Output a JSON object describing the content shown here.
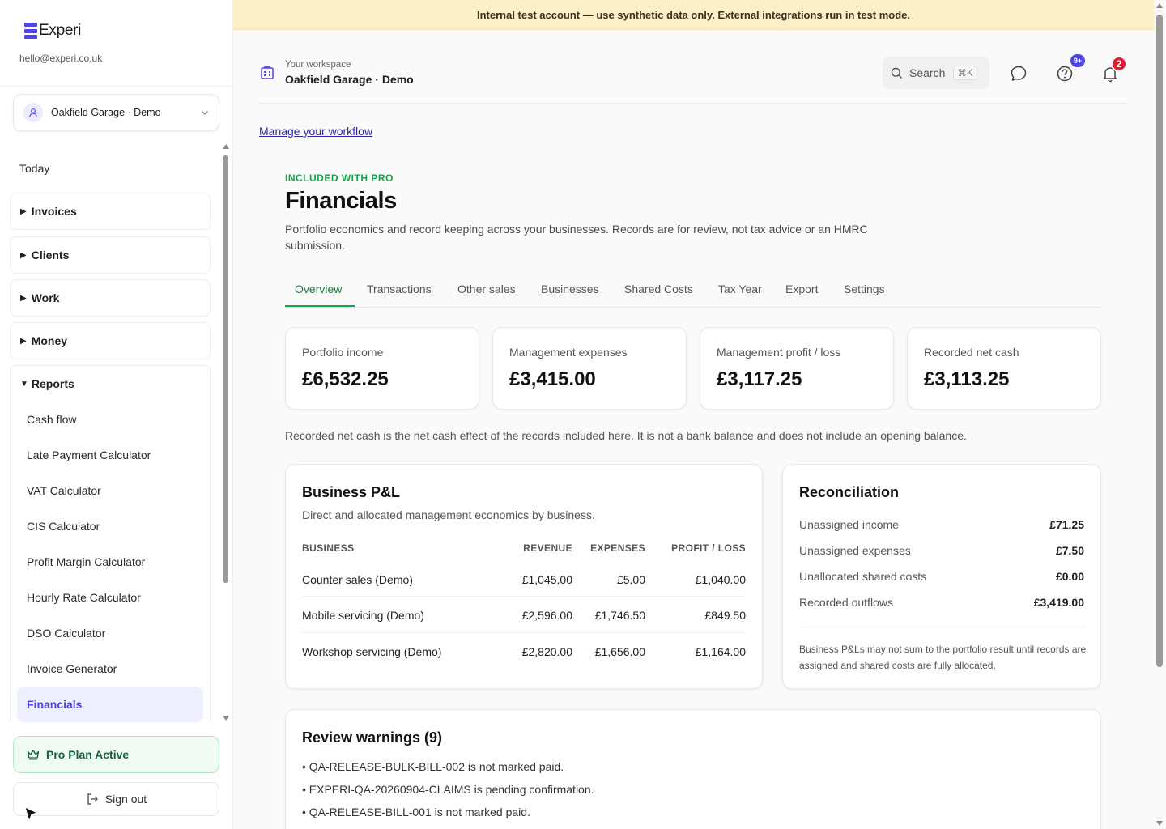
{
  "brand": {
    "name": "Experi",
    "email": "hello@experi.co.uk"
  },
  "workspace_select": {
    "label": "Oakfield Garage · Demo"
  },
  "nav": {
    "today": "Today",
    "groups": [
      {
        "label": "Invoices"
      },
      {
        "label": "Clients"
      },
      {
        "label": "Work"
      },
      {
        "label": "Money"
      }
    ],
    "reports": {
      "label": "Reports",
      "items": [
        {
          "label": "Cash flow"
        },
        {
          "label": "Late Payment Calculator"
        },
        {
          "label": "VAT Calculator"
        },
        {
          "label": "CIS Calculator"
        },
        {
          "label": "Profit Margin Calculator"
        },
        {
          "label": "Hourly Rate Calculator"
        },
        {
          "label": "DSO Calculator"
        },
        {
          "label": "Invoice Generator"
        },
        {
          "label": "Financials"
        }
      ],
      "active": "Financials"
    }
  },
  "pro_plan": {
    "label": "Pro Plan Active"
  },
  "sign_out": {
    "label": "Sign out"
  },
  "banner": {
    "text": "Internal test account — use synthetic data only. External integrations run in test mode."
  },
  "topbar": {
    "workspace_small": "Your workspace",
    "workspace_name": "Oakfield Garage · Demo",
    "search_label": "Search",
    "search_shortcut": "⌘K",
    "help_badge": "9+",
    "notif_badge": "2"
  },
  "manage_link": "Manage your workflow",
  "header": {
    "eyebrow": "INCLUDED WITH PRO",
    "title": "Financials",
    "description": "Portfolio economics and record keeping across your businesses. Records are for review, not tax advice or an HMRC submission."
  },
  "tabs": [
    {
      "label": "Overview"
    },
    {
      "label": "Transactions"
    },
    {
      "label": "Other sales"
    },
    {
      "label": "Businesses"
    },
    {
      "label": "Shared Costs"
    },
    {
      "label": "Tax Year"
    },
    {
      "label": "Export"
    },
    {
      "label": "Settings"
    }
  ],
  "kpis": [
    {
      "label": "Portfolio income",
      "value": "£6,532.25"
    },
    {
      "label": "Management expenses",
      "value": "£3,415.00"
    },
    {
      "label": "Management profit / loss",
      "value": "£3,117.25"
    },
    {
      "label": "Recorded net cash",
      "value": "£3,113.25"
    }
  ],
  "net_cash_note": "Recorded net cash is the net cash effect of the records included here. It is not a bank balance and does not include an opening balance.",
  "pl": {
    "title": "Business P&L",
    "subtitle": "Direct and allocated management economics by business.",
    "headers": {
      "business": "BUSINESS",
      "revenue": "REVENUE",
      "expenses": "EXPENSES",
      "profit": "PROFIT / LOSS"
    },
    "rows": [
      {
        "business": "Counter sales (Demo)",
        "revenue": "£1,045.00",
        "expenses": "£5.00",
        "profit": "£1,040.00"
      },
      {
        "business": "Mobile servicing (Demo)",
        "revenue": "£2,596.00",
        "expenses": "£1,746.50",
        "profit": "£849.50"
      },
      {
        "business": "Workshop servicing (Demo)",
        "revenue": "£2,820.00",
        "expenses": "£1,656.00",
        "profit": "£1,164.00"
      }
    ]
  },
  "reconciliation": {
    "title": "Reconciliation",
    "rows": [
      {
        "label": "Unassigned income",
        "value": "£71.25"
      },
      {
        "label": "Unassigned expenses",
        "value": "£7.50"
      },
      {
        "label": "Unallocated shared costs",
        "value": "£0.00"
      },
      {
        "label": "Recorded outflows",
        "value": "£3,419.00"
      }
    ],
    "note": "Business P&Ls may not sum to the portfolio result until records are assigned and shared costs are fully allocated."
  },
  "warnings": {
    "title": "Review warnings (9)",
    "items": [
      "• QA-RELEASE-BULK-BILL-002 is not marked paid.",
      "• EXPERI-QA-20260904-CLAIMS is pending confirmation.",
      "• QA-RELEASE-BILL-001 is not marked paid."
    ]
  },
  "colors": {
    "accent": "#4f46e5",
    "success": "#16a34a",
    "banner": "#fbefc6",
    "badge_help": "#4f46e5",
    "badge_notif": "#e11d2e"
  }
}
